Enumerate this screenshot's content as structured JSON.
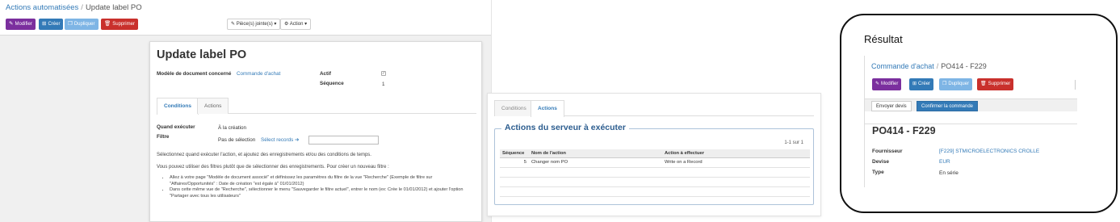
{
  "left_panel": {
    "breadcrumb": {
      "parent": "Actions automatisées",
      "separator": "/",
      "current": "Update label PO"
    },
    "buttons": {
      "edit": "Modifier",
      "create": "Créer",
      "duplicate": "Dupliquer",
      "delete": "Supprimer"
    },
    "dropdowns": {
      "attachments": "Pièce(s) jointe(s)",
      "action": "Action"
    },
    "sheet": {
      "title": "Update label PO",
      "fields": {
        "model_label": "Modèle de document concerné",
        "model_value": "Commande d'achat",
        "active_label": "Actif",
        "active_checked": true,
        "sequence_label": "Séquence",
        "sequence_value": "1"
      },
      "tabs": [
        {
          "label": "Conditions",
          "active": true
        },
        {
          "label": "Actions",
          "active": false
        }
      ],
      "trigger_label": "Quand exécuter",
      "trigger_value": "À la création",
      "filter_label": "Filtre",
      "filter_none": "Pas de sélection",
      "filter_select": "Sélect records",
      "help_text": "Sélectionnez quand exécuter l'action, et ajoutez des enregistrements et/ou des conditions de temps.",
      "help_text_2": "Vous pouvez utiliser des filtres plutôt que de sélectionner des enregistrements. Pour créer un nouveau filtre :",
      "help_bullets": [
        "Allez à votre page \"Modèle de document associé\" et définissez les paramètres du filtre de la vue \"Recherche\" (Exemple de filtre sur \"Affaires/Opportunités\" : Date de création \"est égale à\" 01/01/2012)",
        "Dans cette même vue de \"Recherche\", sélectionner le menu \"Sauvegarder le filtre actuel\", entrer le nom (ex: Crée le 01/01/2012) et ajouter l'option \"Partager avec tous les utilisateurs\""
      ]
    }
  },
  "middle_panel": {
    "tabs": [
      {
        "label": "Conditions",
        "active": false
      },
      {
        "label": "Actions",
        "active": true
      }
    ],
    "section_title": "Actions du serveur à exécuter",
    "pager": "1-1 sur 1",
    "columns": [
      "Séquence",
      "Nom de l'action",
      "Action à effectuer"
    ],
    "rows": [
      {
        "sequence": "5",
        "name": "Changer nom PO",
        "action": "Write on a Record"
      }
    ]
  },
  "right_panel": {
    "title": "Résultat",
    "breadcrumb": {
      "parent": "Commande d'achat",
      "separator": "/",
      "current": "PO414 - F229"
    },
    "buttons": {
      "edit": "Modifier",
      "create": "Créer",
      "duplicate": "Dupliquer",
      "delete": "Supprimer"
    },
    "workflow": {
      "send": "Envoyer devis",
      "confirm": "Confirmer la commande"
    },
    "record_name": "PO414 - F229",
    "fields": [
      {
        "label": "Fournisseur",
        "value": "[F229] STMICROELECTRONICS CROLLE",
        "link": true
      },
      {
        "label": "Devise",
        "value": "EUR",
        "link": true
      },
      {
        "label": "Type",
        "value": "En série",
        "link": false
      }
    ]
  },
  "colors": {
    "primary": "#337ab7",
    "edit": "#7b2f9e",
    "duplicate": "#7eb5e5",
    "delete": "#c9302c",
    "legend": "#2c5d8f"
  },
  "icons": {
    "edit": "pencil-icon",
    "create": "plus-square-icon",
    "duplicate": "copy-icon",
    "delete": "trash-icon",
    "attachments": "paperclip-icon",
    "action": "gear-icon",
    "select": "arrow-right-icon",
    "dropdown": "caret-down-icon"
  }
}
